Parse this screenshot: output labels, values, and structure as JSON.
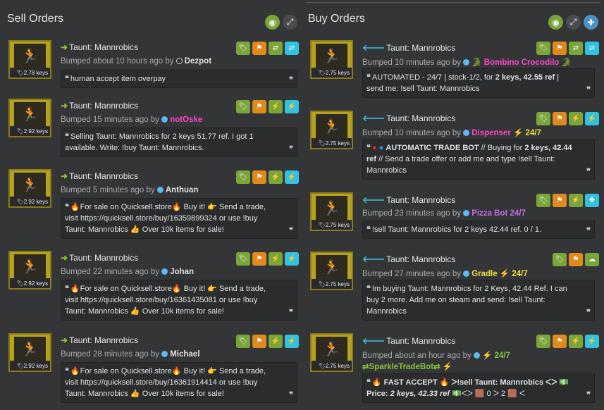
{
  "sell": {
    "title": "Sell Orders",
    "listings": [
      {
        "price": "2.78 keys",
        "item": "Taunt: Mannrobics",
        "bumped": "Bumped about 10 hours ago by",
        "user": "Dezpot",
        "message": "human accept item overpay"
      },
      {
        "price": "2.92 keys",
        "item": "Taunt: Mannrobics",
        "bumped": "Bumped 15 minutes ago by",
        "user": "notOske",
        "message": "Selling Taunt: Mannrobics for 2 keys 51.77 ref. I got 1 available. Write: !buy Taunt: Mannrobics."
      },
      {
        "price": "2.92 keys",
        "item": "Taunt: Mannrobics",
        "bumped": "Bumped 5 minutes ago by",
        "user": "Anthuan",
        "message": "🔥For sale on Quicksell.store🔥 Buy it! 👉 Send a trade, visit https://quicksell.store/buy/16359899324 or use !buy Taunt: Mannrobics 👍 Over 10k items for sale!"
      },
      {
        "price": "2.92 keys",
        "item": "Taunt: Mannrobics",
        "bumped": "Bumped 22 minutes ago by",
        "user": "Johan",
        "message": "🔥For sale on Quicksell.store🔥 Buy it! 👉 Send a trade, visit https://quicksell.store/buy/16361435081 or use !buy Taunt: Mannrobics 👍 Over 10k items for sale!"
      },
      {
        "price": "2.92 keys",
        "item": "Taunt: Mannrobics",
        "bumped": "Bumped 28 minutes ago by",
        "user": "Michael",
        "message": "🔥For sale on Quicksell.store🔥 Buy it! 👉 Send a trade, visit https://quicksell.store/buy/16361914414 or use !buy Taunt: Mannrobics 👍 Over 10k items for sale!"
      }
    ]
  },
  "buy": {
    "title": "Buy Orders",
    "listings": [
      {
        "price": "2.75 keys",
        "item": "Taunt: Mannrobics",
        "bumped": "Bumped 10 minutes ago by",
        "user": "Bombino Crocodilo",
        "message_a": "AUTOMATED - 24/7 | stock-1/2, for ",
        "message_b": "2 keys, 42.55 ref",
        "message_c": " | send me: !sell Taunt: Mannrobics"
      },
      {
        "price": "2.75 keys",
        "item": "Taunt: Mannrobics",
        "bumped": "Bumped 10 minutes ago by",
        "user": "Dispenser",
        "tag": "24/7",
        "message_a": "AUTOMATIC TRADE BOT",
        "message_b": " // Buying for ",
        "message_c": "2 keys, 42.44 ref",
        "message_d": " // Send a trade offer or add me and type !sell Taunt: Mannrobics"
      },
      {
        "price": "2.75 keys",
        "item": "Taunt: Mannrobics",
        "bumped": "Bumped 23 minutes ago by",
        "user": "Pizza Bot 24/7",
        "message": "!sell Taunt: Mannrobics for 2 keys 42.44 ref. 0 / 1."
      },
      {
        "price": "2.75 keys",
        "item": "Taunt: Mannrobics",
        "bumped": "Bumped 27 minutes ago by",
        "user": "Gradle",
        "tag": "24/7",
        "message": "Im buying Taunt: Mannrobics for 2 Keys, 42.44 Ref. I can buy 2 more. Add me on steam and send: !sell Taunt: Mannrobics"
      },
      {
        "price": "2.75 keys",
        "item": "Taunt: Mannrobics",
        "bumped": "Bumped about an hour ago by",
        "user_tag": "24/7",
        "user": "⇄SparkleTradeBot⇄",
        "message_a": "🔥 FAST ACCEPT 🔥 ᐳ!sell Taunt: Mannrobics ᐸᐳ 💵 Price: ",
        "message_b": "2 keys, 42.33 ref",
        "message_c": " 💵ᐸᐳ 🟫 0 ᐳ 2 🟫 ᐸ"
      }
    ]
  },
  "colors": {
    "bg": "#343536",
    "green": "#7aa53a",
    "orange": "#e08a1e",
    "cyan": "#34c1e0",
    "thumb": "#b7a21e"
  }
}
